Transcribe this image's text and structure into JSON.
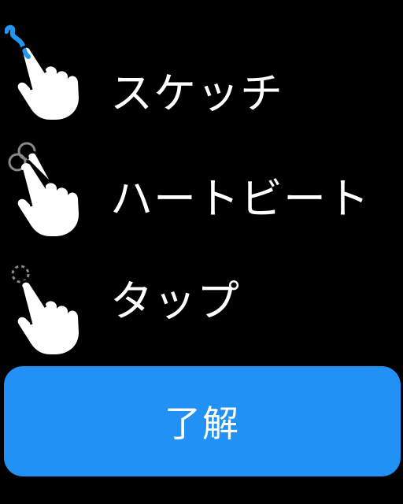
{
  "gestures": [
    {
      "label": "スケッチ",
      "icon": "sketch-gesture-icon"
    },
    {
      "label": "ハートビート",
      "icon": "heartbeat-gesture-icon"
    },
    {
      "label": "タップ",
      "icon": "tap-gesture-icon"
    }
  ],
  "button": {
    "label": "了解"
  },
  "colors": {
    "background": "#000000",
    "accent": "#2196f3",
    "button": "#2191f5",
    "text": "#ffffff"
  }
}
